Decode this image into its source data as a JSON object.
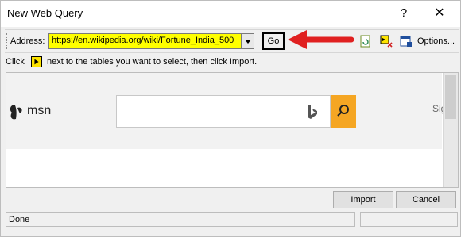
{
  "window": {
    "title": "New Web Query",
    "help_glyph": "?",
    "close_glyph": "✕"
  },
  "toolbar": {
    "address_label": "Address:",
    "address_value": "https://en.wikipedia.org/wiki/Fortune_India_500",
    "go_label": "Go",
    "options_label": "Options...",
    "icons": [
      "back-icon",
      "forward-icon",
      "stop-icon",
      "refresh-icon",
      "save-query-icon",
      "options-icon"
    ]
  },
  "instruction": {
    "prefix": "Click",
    "suffix": "next to the tables you want to select, then click Import."
  },
  "web": {
    "brand": "msn",
    "sign_in_partial": "Sign"
  },
  "buttons": {
    "import_label": "Import",
    "cancel_label": "Cancel"
  },
  "status": {
    "text": "Done"
  },
  "colors": {
    "address_highlight": "#ffff00",
    "annotation_arrow": "#e02020",
    "search_button": "#f5a623",
    "select_marker": "#fde300"
  }
}
